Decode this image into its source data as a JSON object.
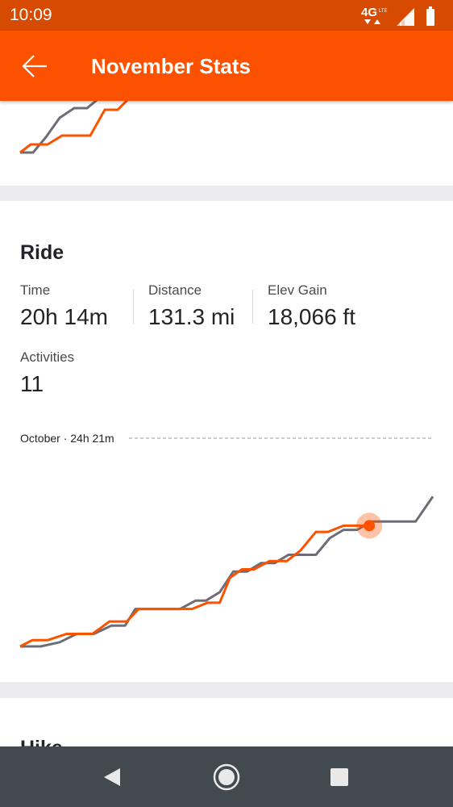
{
  "status_bar": {
    "time": "10:09",
    "network": "4G LTE",
    "icons": [
      "network-type-icon",
      "signal-icon",
      "battery-icon"
    ]
  },
  "app_bar": {
    "title": "November Stats",
    "back_icon": "arrow-left-icon"
  },
  "colors": {
    "brand": "#fc5200",
    "status_bar": "#d74a02",
    "current_month_line": "#fc5200",
    "previous_month_line": "#6d6d78",
    "nav_bar": "#434a4f"
  },
  "ride": {
    "title": "Ride",
    "stats": [
      {
        "label": "Time",
        "value": "20h 14m"
      },
      {
        "label": "Distance",
        "value": "131.3 mi"
      },
      {
        "label": "Elev Gain",
        "value": "18,066 ft"
      },
      {
        "label": "Activities",
        "value": "11"
      }
    ],
    "reference_line_label": "October · 24h 21m"
  },
  "next_section": {
    "title": "Hike"
  },
  "navigation": {
    "icons": [
      "back-triangle-icon",
      "home-circle-icon",
      "recents-square-icon"
    ]
  },
  "chart_data": {
    "type": "line",
    "title": "",
    "xlabel": "",
    "ylabel": "",
    "grid": false,
    "legend": "none",
    "reference": {
      "label": "October · 24h 21m",
      "value_hours": 24.35
    },
    "ylim": [
      0,
      24.35
    ],
    "series": [
      {
        "color": "#6d6d78",
        "points": [
          [
            0,
            0
          ],
          [
            1.2,
            0
          ],
          [
            2.3,
            0.49
          ],
          [
            3.3,
            1.47
          ],
          [
            4.3,
            1.47
          ],
          [
            5.3,
            2.43
          ],
          [
            6.1,
            2.43
          ],
          [
            6.7,
            4.38
          ],
          [
            7.7,
            4.38
          ],
          [
            8.5,
            4.38
          ],
          [
            9.3,
            4.38
          ],
          [
            10.2,
            5.35
          ],
          [
            10.8,
            5.35
          ],
          [
            11.6,
            6.33
          ],
          [
            12.4,
            8.76
          ],
          [
            13.2,
            8.76
          ],
          [
            14.0,
            9.74
          ],
          [
            14.8,
            9.74
          ],
          [
            15.6,
            10.71
          ],
          [
            16.4,
            10.71
          ],
          [
            17.2,
            10.71
          ],
          [
            18.0,
            12.66
          ],
          [
            18.8,
            13.63
          ],
          [
            19.6,
            13.63
          ],
          [
            20.4,
            14.61
          ],
          [
            21.2,
            14.61
          ],
          [
            22.0,
            14.61
          ],
          [
            23.0,
            14.61
          ],
          [
            24.0,
            17.53
          ]
        ]
      },
      {
        "color": "#fc5200",
        "points": [
          [
            0,
            0
          ],
          [
            0.7,
            0.73
          ],
          [
            1.6,
            0.73
          ],
          [
            2.7,
            1.46
          ],
          [
            4.2,
            1.46
          ],
          [
            5.2,
            2.92
          ],
          [
            6.2,
            2.92
          ],
          [
            6.9,
            4.38
          ],
          [
            8.5,
            4.38
          ],
          [
            9.4,
            4.38
          ],
          [
            10.0,
            4.38
          ],
          [
            10.9,
            5.11
          ],
          [
            11.6,
            5.11
          ],
          [
            12.2,
            8.03
          ],
          [
            12.9,
            9.01
          ],
          [
            13.6,
            9.01
          ],
          [
            14.5,
            9.98
          ],
          [
            15.5,
            9.98
          ],
          [
            16.3,
            11.2
          ],
          [
            17.2,
            13.39
          ],
          [
            17.9,
            13.39
          ],
          [
            18.8,
            14.12
          ],
          [
            19.5,
            14.12
          ],
          [
            20.3,
            14.12
          ]
        ]
      }
    ],
    "highlight_point": [
      20.3,
      14.12
    ]
  }
}
